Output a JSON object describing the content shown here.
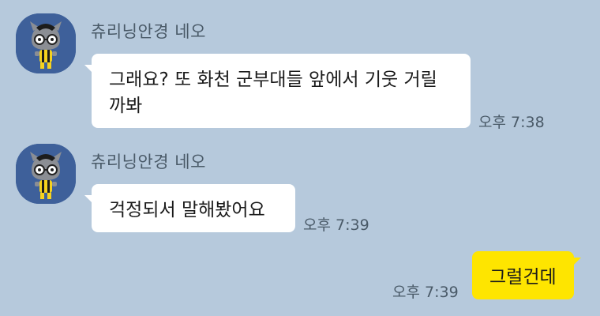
{
  "messages": [
    {
      "sender": "츄리닝안경 네오",
      "avatar_icon": "neo-character-avatar-icon",
      "text": "그래요? 또 화천 군부대들 앞에서 기웃 거릴\n까봐",
      "time": "오후 7:38"
    },
    {
      "sender": "츄리닝안경 네오",
      "avatar_icon": "neo-character-avatar-icon",
      "text": "걱정되서 말해봤어요",
      "time": "오후 7:39"
    },
    {
      "text": "그럴건데",
      "time": "오후 7:39"
    }
  ],
  "colors": {
    "background": "#b6c9dc",
    "incoming_bubble": "#ffffff",
    "outgoing_bubble": "#fee500",
    "avatar_bg": "#3e609a"
  }
}
